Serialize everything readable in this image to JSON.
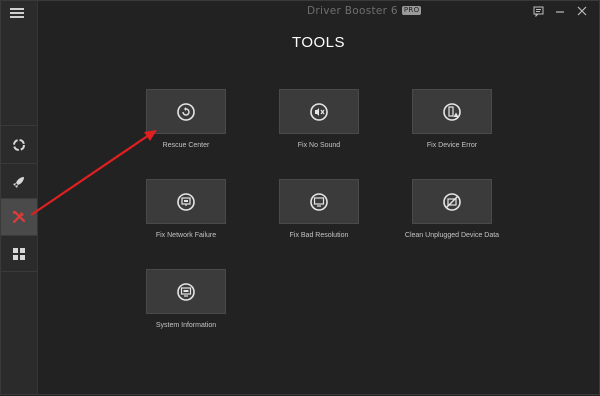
{
  "window": {
    "app_name": "Driver Booster 6",
    "pro_badge": "PRO",
    "feedback_icon": "feedback-icon",
    "minimize_icon": "minimize-icon",
    "close_icon": "close-icon"
  },
  "page": {
    "title": "TOOLS"
  },
  "sidebar": {
    "menu_icon": "hamburger-menu-icon",
    "items": [
      {
        "name": "scan",
        "icon": "scan-ring-icon",
        "active": false
      },
      {
        "name": "boost",
        "icon": "rocket-icon",
        "active": false
      },
      {
        "name": "tools",
        "icon": "tools-icon",
        "active": true
      },
      {
        "name": "action-center",
        "icon": "grid-icon",
        "active": false
      }
    ]
  },
  "tools": [
    {
      "label": "Rescue Center",
      "icon": "rescue-center-icon"
    },
    {
      "label": "Fix No Sound",
      "icon": "speaker-mute-icon"
    },
    {
      "label": "Fix Device Error",
      "icon": "device-error-icon"
    },
    {
      "label": "Fix Network Failure",
      "icon": "network-icon"
    },
    {
      "label": "Fix Bad Resolution",
      "icon": "monitor-icon"
    },
    {
      "label": "Clean Unplugged Device Data",
      "icon": "unplugged-device-icon"
    },
    {
      "label": "System Information",
      "icon": "system-info-icon"
    }
  ],
  "colors": {
    "background": "#222222",
    "sidebar": "#2b2b2b",
    "tile": "#3b3b3b",
    "active_item": "#4a4a4a",
    "tools_icon_red": "#e03a3a",
    "annotation_arrow": "#e02020"
  }
}
